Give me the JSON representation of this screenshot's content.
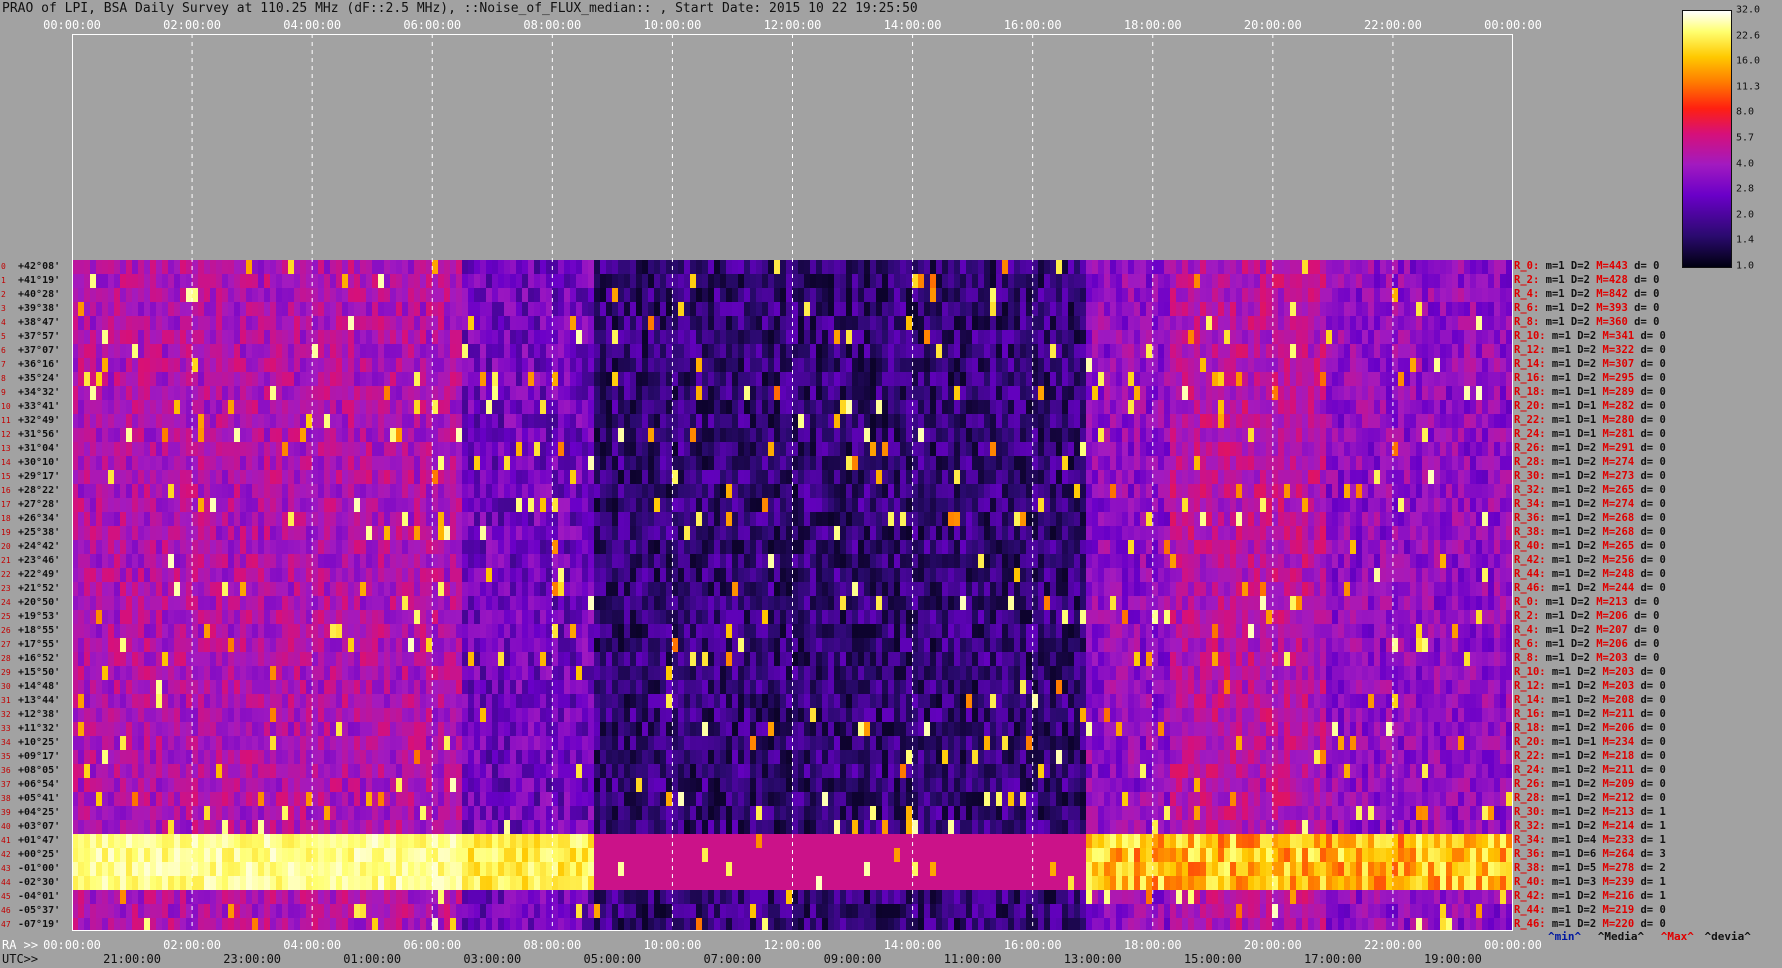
{
  "title": "PRAO of LPI, BSA Daily Survey at 110.25 MHz (dF::2.5 MHz), ::Noise_of_FLUX_median:: , Start Date: 2015 10 22 19:25:50",
  "axis_prefix": {
    "ra": "RA >>",
    "utc": "UTC>>"
  },
  "legend_keys": [
    "^min^",
    "^Media^",
    "^Max^",
    "^devia^"
  ],
  "colors": {
    "background": "#a2a2a2",
    "stat_red": "#e00000",
    "text": "#111111"
  },
  "chart_data": {
    "type": "heatmap",
    "title": "PRAO of LPI, BSA Daily Survey at 110.25 MHz (dF::2.5 MHz), ::Noise_of_FLUX_median:: , Start Date: 2015 10 22 19:25:50",
    "top_ticks": [
      "00:00:00",
      "02:00:00",
      "04:00:00",
      "06:00:00",
      "08:00:00",
      "10:00:00",
      "12:00:00",
      "14:00:00",
      "16:00:00",
      "18:00:00",
      "20:00:00",
      "22:00:00",
      "00:00:00"
    ],
    "ra_ticks": [
      "00:00:00",
      "02:00:00",
      "04:00:00",
      "06:00:00",
      "08:00:00",
      "10:00:00",
      "12:00:00",
      "14:00:00",
      "16:00:00",
      "18:00:00",
      "20:00:00",
      "22:00:00",
      "00:00:00"
    ],
    "utc_ticks": [
      "21:00:00",
      "23:00:00",
      "01:00:00",
      "03:00:00",
      "05:00:00",
      "07:00:00",
      "09:00:00",
      "11:00:00",
      "13:00:00",
      "15:00:00",
      "17:00:00",
      "19:00:00"
    ],
    "declinations": [
      "+42°08'",
      "+41°19'",
      "+40°28'",
      "+39°38'",
      "+38°47'",
      "+37°57'",
      "+37°07'",
      "+36°16'",
      "+35°24'",
      "+34°32'",
      "+33°41'",
      "+32°49'",
      "+31°56'",
      "+31°04'",
      "+30°10'",
      "+29°17'",
      "+28°22'",
      "+27°28'",
      "+26°34'",
      "+25°38'",
      "+24°42'",
      "+23°46'",
      "+22°49'",
      "+21°52'",
      "+20°50'",
      "+19°53'",
      "+18°55'",
      "+17°55'",
      "+16°52'",
      "+15°50'",
      "+14°48'",
      "+13°44'",
      "+12°38'",
      "+11°32'",
      "+10°25'",
      "+09°17'",
      "+08°05'",
      "+06°54'",
      "+05°41'",
      "+04°25'",
      "+03°07'",
      "+01°47'",
      "+00°25'",
      "-01°00'",
      "-02°30'",
      "-04°01'",
      "-05°37'",
      "-07°19'"
    ],
    "row_stats": [
      {
        "r": "R_0:",
        "min": "1",
        "d": "2",
        "max": "443",
        "dev": "0"
      },
      {
        "r": "R_2:",
        "min": "1",
        "d": "2",
        "max": "428",
        "dev": "0"
      },
      {
        "r": "R_4:",
        "min": "1",
        "d": "2",
        "max": "842",
        "dev": "0"
      },
      {
        "r": "R_6:",
        "min": "1",
        "d": "2",
        "max": "393",
        "dev": "0"
      },
      {
        "r": "R_8:",
        "min": "1",
        "d": "2",
        "max": "360",
        "dev": "0"
      },
      {
        "r": "R_10:",
        "min": "1",
        "d": "2",
        "max": "341",
        "dev": "0"
      },
      {
        "r": "R_12:",
        "min": "1",
        "d": "2",
        "max": "322",
        "dev": "0"
      },
      {
        "r": "R_14:",
        "min": "1",
        "d": "2",
        "max": "307",
        "dev": "0"
      },
      {
        "r": "R_16:",
        "min": "1",
        "d": "2",
        "max": "295",
        "dev": "0"
      },
      {
        "r": "R_18:",
        "min": "1",
        "d": "1",
        "max": "289",
        "dev": "0"
      },
      {
        "r": "R_20:",
        "min": "1",
        "d": "1",
        "max": "282",
        "dev": "0"
      },
      {
        "r": "R_22:",
        "min": "1",
        "d": "1",
        "max": "280",
        "dev": "0"
      },
      {
        "r": "R_24:",
        "min": "1",
        "d": "1",
        "max": "281",
        "dev": "0"
      },
      {
        "r": "R_26:",
        "min": "1",
        "d": "2",
        "max": "291",
        "dev": "0"
      },
      {
        "r": "R_28:",
        "min": "1",
        "d": "2",
        "max": "274",
        "dev": "0"
      },
      {
        "r": "R_30:",
        "min": "1",
        "d": "2",
        "max": "273",
        "dev": "0"
      },
      {
        "r": "R_32:",
        "min": "1",
        "d": "2",
        "max": "265",
        "dev": "0"
      },
      {
        "r": "R_34:",
        "min": "1",
        "d": "2",
        "max": "274",
        "dev": "0"
      },
      {
        "r": "R_36:",
        "min": "1",
        "d": "2",
        "max": "268",
        "dev": "0"
      },
      {
        "r": "R_38:",
        "min": "1",
        "d": "2",
        "max": "268",
        "dev": "0"
      },
      {
        "r": "R_40:",
        "min": "1",
        "d": "2",
        "max": "265",
        "dev": "0"
      },
      {
        "r": "R_42:",
        "min": "1",
        "d": "2",
        "max": "256",
        "dev": "0"
      },
      {
        "r": "R_44:",
        "min": "1",
        "d": "2",
        "max": "248",
        "dev": "0"
      },
      {
        "r": "R_46:",
        "min": "1",
        "d": "2",
        "max": "244",
        "dev": "0"
      },
      {
        "r": "R_0:",
        "min": "1",
        "d": "2",
        "max": "213",
        "dev": "0"
      },
      {
        "r": "R_2:",
        "min": "1",
        "d": "2",
        "max": "206",
        "dev": "0"
      },
      {
        "r": "R_4:",
        "min": "1",
        "d": "2",
        "max": "207",
        "dev": "0"
      },
      {
        "r": "R_6:",
        "min": "1",
        "d": "2",
        "max": "206",
        "dev": "0"
      },
      {
        "r": "R_8:",
        "min": "1",
        "d": "2",
        "max": "203",
        "dev": "0"
      },
      {
        "r": "R_10:",
        "min": "1",
        "d": "2",
        "max": "203",
        "dev": "0"
      },
      {
        "r": "R_12:",
        "min": "1",
        "d": "2",
        "max": "203",
        "dev": "0"
      },
      {
        "r": "R_14:",
        "min": "1",
        "d": "2",
        "max": "208",
        "dev": "0"
      },
      {
        "r": "R_16:",
        "min": "1",
        "d": "2",
        "max": "211",
        "dev": "0"
      },
      {
        "r": "R_18:",
        "min": "1",
        "d": "2",
        "max": "206",
        "dev": "0"
      },
      {
        "r": "R_20:",
        "min": "1",
        "d": "1",
        "max": "234",
        "dev": "0"
      },
      {
        "r": "R_22:",
        "min": "1",
        "d": "2",
        "max": "218",
        "dev": "0"
      },
      {
        "r": "R_24:",
        "min": "1",
        "d": "2",
        "max": "211",
        "dev": "0"
      },
      {
        "r": "R_26:",
        "min": "1",
        "d": "2",
        "max": "209",
        "dev": "0"
      },
      {
        "r": "R_28:",
        "min": "1",
        "d": "2",
        "max": "212",
        "dev": "0"
      },
      {
        "r": "R_30:",
        "min": "1",
        "d": "2",
        "max": "213",
        "dev": "1"
      },
      {
        "r": "R_32:",
        "min": "1",
        "d": "2",
        "max": "214",
        "dev": "1"
      },
      {
        "r": "R_34:",
        "min": "1",
        "d": "4",
        "max": "233",
        "dev": "1"
      },
      {
        "r": "R_36:",
        "min": "1",
        "d": "6",
        "max": "264",
        "dev": "3"
      },
      {
        "r": "R_38:",
        "min": "1",
        "d": "5",
        "max": "278",
        "dev": "2"
      },
      {
        "r": "R_40:",
        "min": "1",
        "d": "3",
        "max": "239",
        "dev": "1"
      },
      {
        "r": "R_42:",
        "min": "1",
        "d": "2",
        "max": "216",
        "dev": "1"
      },
      {
        "r": "R_44:",
        "min": "1",
        "d": "2",
        "max": "219",
        "dev": "0"
      },
      {
        "r": "R_46:",
        "min": "1",
        "d": "2",
        "max": "220",
        "dev": "0"
      }
    ],
    "colorbar": {
      "ticks": [
        "32.0",
        "22.6",
        "16.0",
        "11.3",
        "8.0",
        "5.7",
        "4.0",
        "2.8",
        "2.0",
        "1.4",
        "1.0"
      ],
      "range": [
        1.0,
        32.0
      ],
      "scale": "log",
      "colors": [
        "#000010",
        "#2a0a6e",
        "#6a00c8",
        "#a21ac0",
        "#d6107a",
        "#ff2010",
        "#ff7a00",
        "#ffc800",
        "#ffff70",
        "#ffffff"
      ]
    }
  }
}
